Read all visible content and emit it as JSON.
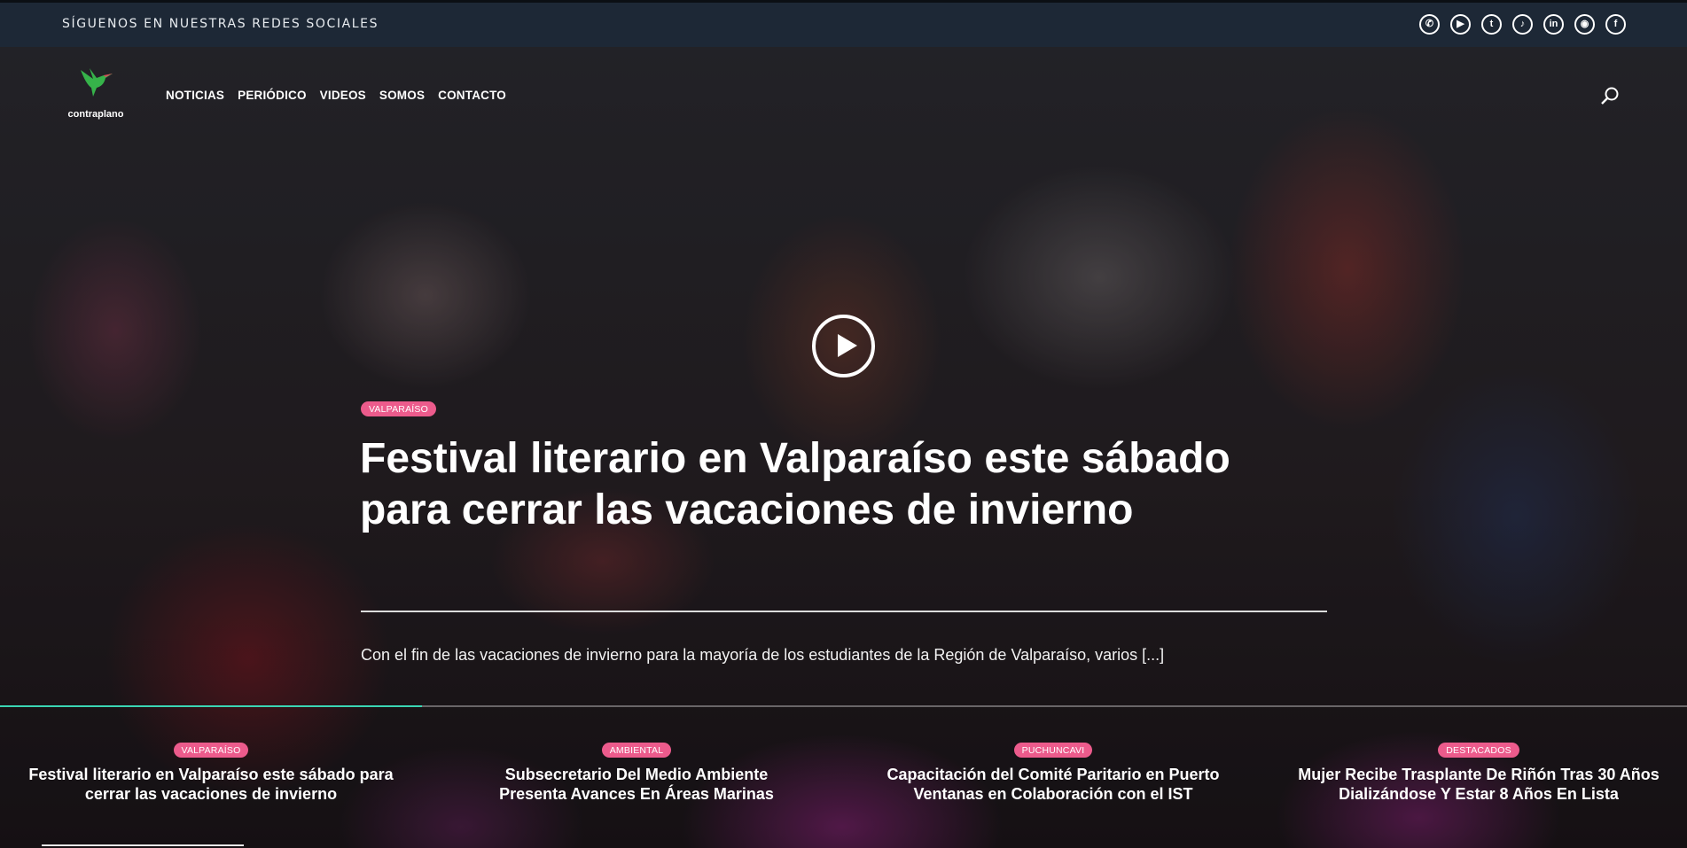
{
  "topbar": {
    "text": "SÍGUENOS EN NUESTRAS REDES SOCIALES",
    "social": [
      {
        "icon": "whatsapp-icon",
        "glyph": "✆"
      },
      {
        "icon": "youtube-icon",
        "glyph": "▶"
      },
      {
        "icon": "twitter-icon",
        "glyph": "t"
      },
      {
        "icon": "tiktok-icon",
        "glyph": "♪"
      },
      {
        "icon": "linkedin-icon",
        "glyph": "in"
      },
      {
        "icon": "instagram-icon",
        "glyph": "◉"
      },
      {
        "icon": "facebook-icon",
        "glyph": "f"
      }
    ]
  },
  "logo": {
    "text": "contraplano",
    "color": "#36b34a"
  },
  "nav": {
    "items": [
      "NOTICIAS",
      "PERIÓDICO",
      "VIDEOS",
      "SOMOS",
      "CONTACTO"
    ]
  },
  "hero": {
    "tag": "VALPARAÍSO",
    "title": "Festival literario en Valparaíso este sábado para cerrar las vacaciones de invierno",
    "excerpt": "Con el fin de las vacaciones de invierno para la mayoría de los estudiantes de la Región de Valparaíso, varios [...]"
  },
  "slider": {
    "progress": 0.25,
    "accent": "#3ad6b4"
  },
  "cards": [
    {
      "tag": "VALPARAÍSO",
      "title": "Festival literario en Valparaíso este sábado para cerrar las vacaciones de invierno"
    },
    {
      "tag": "AMBIENTAL",
      "title": "Subsecretario Del Medio Ambiente Presenta Avances En Áreas Marinas"
    },
    {
      "tag": "PUCHUNCAVI",
      "title": "Capacitación del Comité Paritario en Puerto Ventanas en Colaboración con el IST"
    },
    {
      "tag": "DESTACADOS",
      "title": "Mujer Recibe Trasplante De Riñón Tras 30 Años Dializándose Y Estar 8 Años En Lista"
    }
  ],
  "colors": {
    "tag": "#ec5b8c",
    "topbar": "#1d2836"
  },
  "bottom_progress": {
    "fraction": 0.12
  }
}
